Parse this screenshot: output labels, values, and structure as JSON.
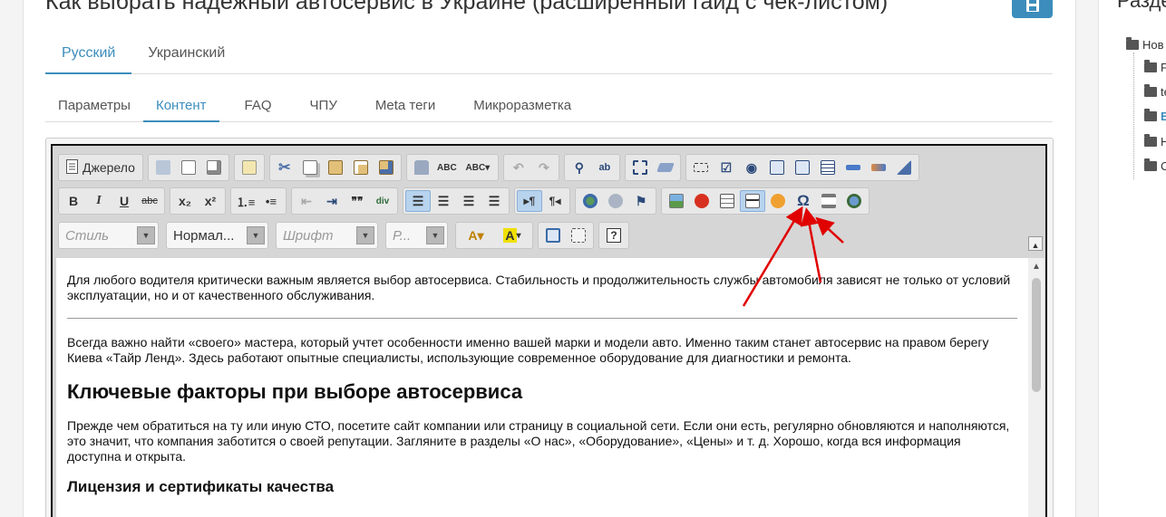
{
  "page": {
    "title": "Как выбрать надежный автосервис в Украине (расширенный гайд с чек-листом)",
    "right_panel_title": "Разде"
  },
  "lang_tabs": [
    "Русский",
    "Украинский"
  ],
  "sub_tabs": [
    "Параметры",
    "Контент",
    "FAQ",
    "ЧПУ",
    "Meta теги",
    "Микроразметка"
  ],
  "toolbar": {
    "source_label": "Джерело",
    "combos": {
      "style": "Стиль",
      "format": "Нормал...",
      "font": "Шрифт",
      "size": "Р..."
    },
    "bold": "B",
    "italic": "I",
    "underline": "U",
    "strike": "abc",
    "subscript": "x₂",
    "superscript": "x²",
    "blockquote": "❞❞"
  },
  "content": {
    "p1": "Для любого водителя критически важным является выбор автосервиса. Стабильность и продолжительность службы автомобиля зависят не только от условий эксплуатации, но и от качественного обслуживания.",
    "p2": "Всегда важно найти «своего» мастера, который учтет особенности именно вашей марки и модели авто. Именно таким станет автосервис на правом берегу Киева «Тайр Ленд». Здесь работают опытные специалисты, использующие современное оборудование для диагностики и ремонта.",
    "h2": "Ключевые факторы при выборе автосервиса",
    "p3": "Прежде чем обратиться на ту или иную СТО, посетите сайт компании или страницу в социальной сети. Если они есть, регулярно обновляются и наполняются, это значит, что компания заботится о своей репутации. Загляните в разделы «О нас», «Оборудование», «Цены» и т. д. Хорошо, когда вся информация доступна и открыта.",
    "h3": "Лицензия и сертификаты качества"
  },
  "tree": {
    "root": "Нов",
    "items": [
      "F",
      "te",
      "E",
      "Н",
      "С"
    ]
  },
  "colors": {
    "accent": "#3c8dbc",
    "arrow": "#e00000"
  }
}
